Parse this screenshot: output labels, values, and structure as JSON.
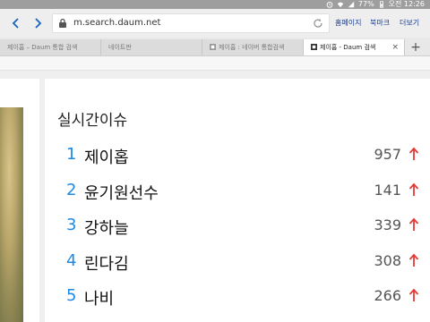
{
  "status_bar": {
    "battery": "77%",
    "time": "오전 12:26"
  },
  "browser": {
    "url": "m.search.daum.net",
    "links": {
      "home": "홈페이지",
      "bookmarks": "북마크",
      "more": "더보기"
    },
    "tabs": [
      {
        "label": "제이홉 – Daum 통합 검색",
        "active": false
      },
      {
        "label": "네이트판",
        "active": false
      },
      {
        "label": "제이홉 : 네이버 통합검색",
        "active": false
      },
      {
        "label": "제이홉 - Daum 검색",
        "active": true
      }
    ],
    "new_tab": "+",
    "close_tab": "×"
  },
  "realtime": {
    "title": "실시간이슈",
    "items": [
      {
        "rank": "1",
        "keyword": "제이홉",
        "count": "957"
      },
      {
        "rank": "2",
        "keyword": "윤기원선수",
        "count": "141"
      },
      {
        "rank": "3",
        "keyword": "강하늘",
        "count": "339"
      },
      {
        "rank": "4",
        "keyword": "린다김",
        "count": "308"
      },
      {
        "rank": "5",
        "keyword": "나비",
        "count": "266"
      }
    ],
    "trend_color": "#e53935"
  },
  "colors": {
    "accent_blue": "#1e88e5",
    "link_blue": "#1a3d8f"
  }
}
